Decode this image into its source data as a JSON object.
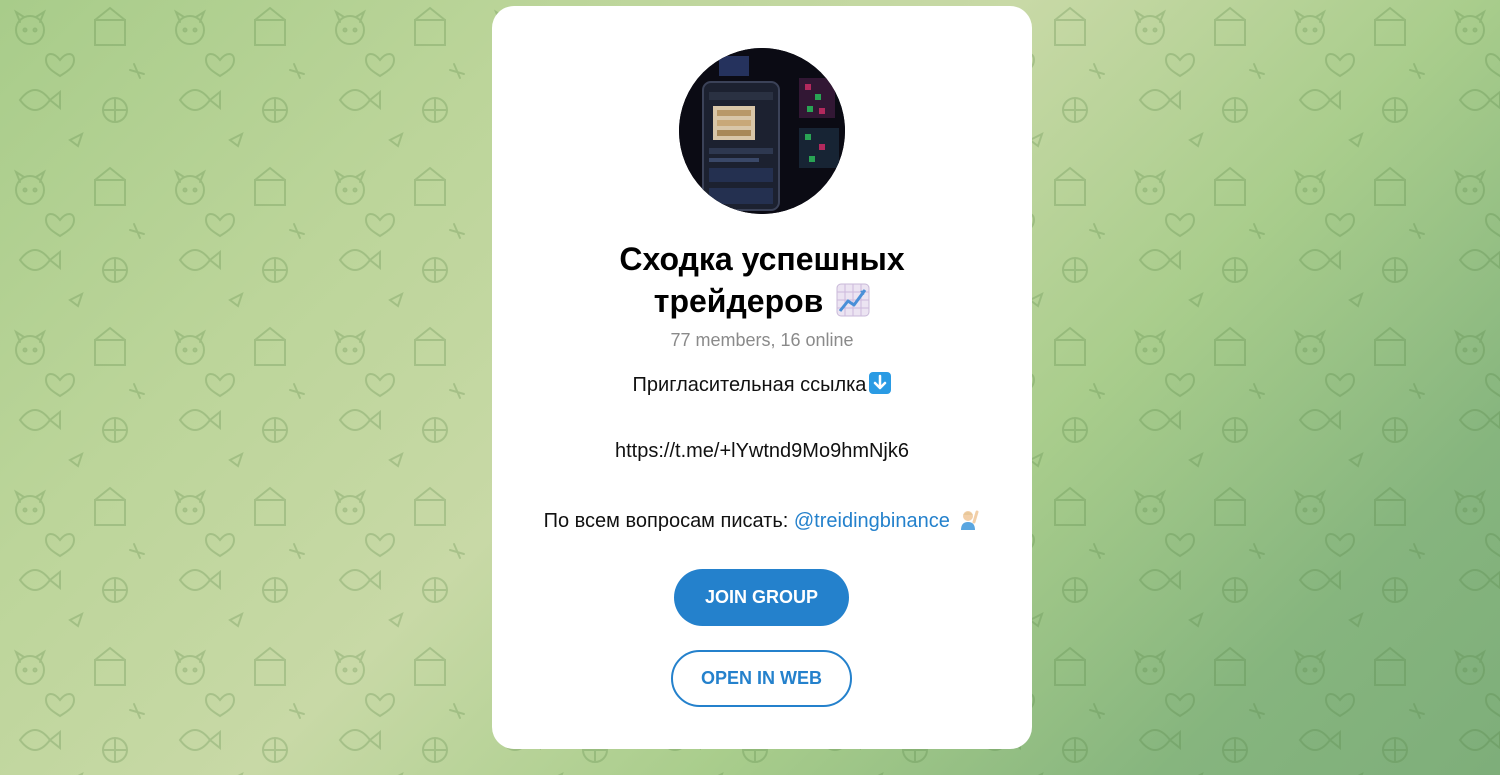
{
  "group": {
    "title_line1": "Сходка успешных",
    "title_line2": "трейдеров",
    "title_icon": "chart-increasing-icon",
    "members": "77 members, 16 online"
  },
  "description": {
    "line1": "Пригласительная ссылка",
    "line1_icon": "down-arrow-icon",
    "invite_link": "https://t.me/+lYwtnd9Mo9hmNjk6",
    "line3_prefix": "По всем вопросам писать: ",
    "contact_username": "@treidingbinance",
    "line3_icon": "person-raising-hand-icon"
  },
  "actions": {
    "join_label": "JOIN GROUP",
    "web_label": "OPEN IN WEB"
  },
  "colors": {
    "accent": "#2481cc",
    "secondary_text": "#8a8a8a",
    "background_green": "#a8cc8a"
  }
}
